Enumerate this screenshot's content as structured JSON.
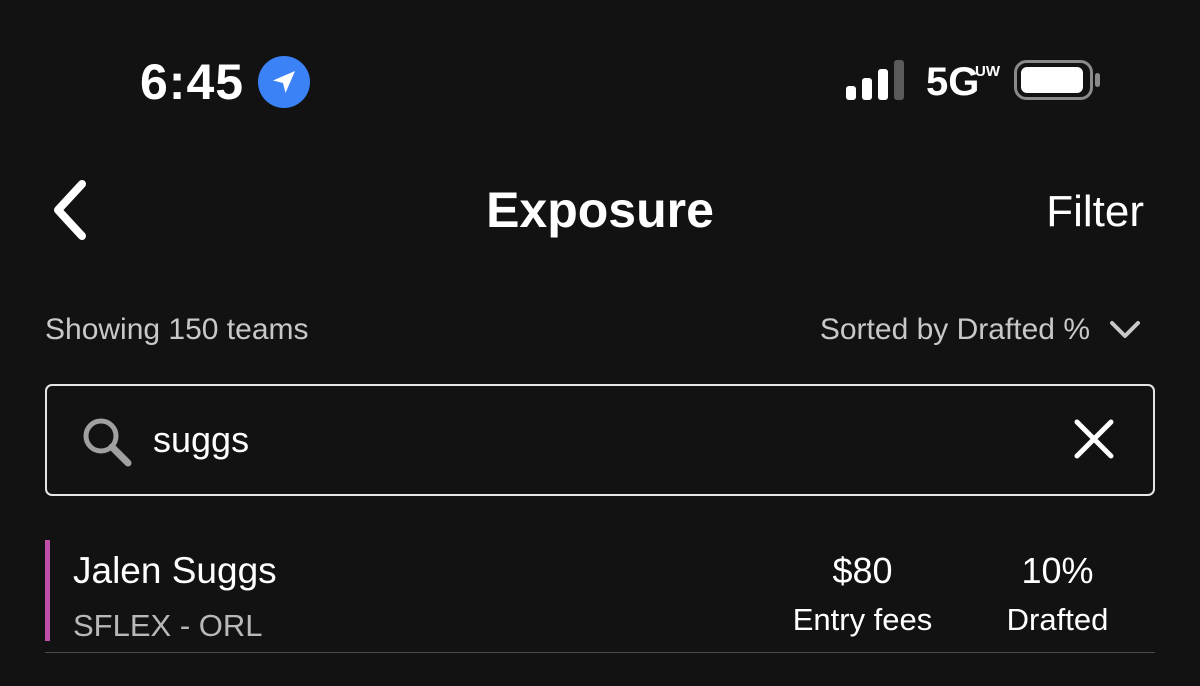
{
  "status_bar": {
    "time": "6:45",
    "network": "5G",
    "network_sub": "UW",
    "location_icon": "location-arrow-icon",
    "signal_icon": "cellular-signal-icon",
    "battery_icon": "battery-icon"
  },
  "header": {
    "title": "Exposure",
    "filter_label": "Filter",
    "back_icon": "chevron-left-icon"
  },
  "summary": {
    "showing_text": "Showing 150 teams",
    "sort_label": "Sorted by Drafted %"
  },
  "search": {
    "value": "suggs",
    "placeholder": ""
  },
  "players": [
    {
      "name": "Jalen Suggs",
      "meta": "SFLEX - ORL",
      "entry_fees": "$80",
      "entry_fees_label": "Entry fees",
      "drafted": "10%",
      "drafted_label": "Drafted",
      "accent_color": "#c04fa7"
    }
  ],
  "colors": {
    "background": "#121212",
    "accent_blue": "#3b82f6",
    "text_secondary": "#c8c8c8"
  }
}
